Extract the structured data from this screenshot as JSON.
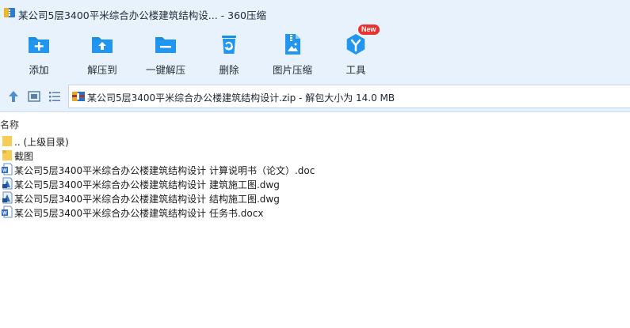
{
  "window": {
    "title": "某公司5层3400平米综合办公楼建筑结构设... - 360压缩"
  },
  "toolbar": {
    "items": [
      {
        "label": "添加",
        "icon": "add-folder-icon"
      },
      {
        "label": "解压到",
        "icon": "extract-to-icon"
      },
      {
        "label": "一键解压",
        "icon": "one-click-extract-icon"
      },
      {
        "label": "删除",
        "icon": "delete-icon"
      },
      {
        "label": "图片压缩",
        "icon": "image-compress-icon"
      },
      {
        "label": "工具",
        "icon": "tools-icon",
        "badge": "New"
      }
    ]
  },
  "navbar": {
    "path": "某公司5层3400平米综合办公楼建筑结构设计.zip - 解包大小为 14.0 MB"
  },
  "list": {
    "column_name": "名称",
    "items": [
      {
        "name": ".. (上级目录)",
        "icon": "parent-folder-icon"
      },
      {
        "name": "截图",
        "icon": "folder-icon"
      },
      {
        "name": "某公司5层3400平米综合办公楼建筑结构设计 计算说明书（论文）.doc",
        "icon": "word-doc-icon"
      },
      {
        "name": "某公司5层3400平米综合办公楼建筑结构设计 建筑施工图.dwg",
        "icon": "dwg-file-icon"
      },
      {
        "name": "某公司5层3400平米综合办公楼建筑结构设计 结构施工图.dwg",
        "icon": "dwg-file-icon"
      },
      {
        "name": "某公司5层3400平米综合办公楼建筑结构设计 任务书.docx",
        "icon": "word-doc-icon"
      }
    ]
  },
  "colors": {
    "toolbar_bg": "#e8f2fc",
    "icon_blue": "#1a8ee0",
    "badge_red": "#e8322f"
  }
}
